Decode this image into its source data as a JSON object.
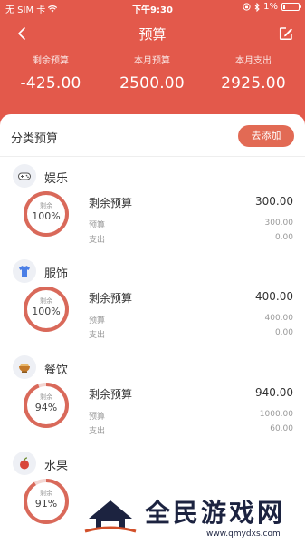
{
  "status_bar": {
    "carrier": "无 SIM 卡",
    "time": "下午9:30",
    "battery_pct": "1%"
  },
  "header": {
    "title": "预算"
  },
  "summary": [
    {
      "label": "剩余预算",
      "value": "-425.00"
    },
    {
      "label": "本月预算",
      "value": "2500.00"
    },
    {
      "label": "本月支出",
      "value": "2925.00"
    }
  ],
  "section": {
    "title": "分类预算",
    "add_label": "去添加"
  },
  "categories": [
    {
      "name": "娱乐",
      "icon": "game-controller-icon",
      "ring_label": "剩余",
      "ring_value": "100%",
      "ring_fraction": 1.0,
      "remaining_label": "剩余预算",
      "remaining": "300.00",
      "budget_label": "预算",
      "budget": "300.00",
      "expense_label": "支出",
      "expense": "0.00"
    },
    {
      "name": "服饰",
      "icon": "shirt-icon",
      "ring_label": "剩余",
      "ring_value": "100%",
      "ring_fraction": 1.0,
      "remaining_label": "剩余预算",
      "remaining": "400.00",
      "budget_label": "预算",
      "budget": "400.00",
      "expense_label": "支出",
      "expense": "0.00"
    },
    {
      "name": "餐饮",
      "icon": "food-bowl-icon",
      "ring_label": "剩余",
      "ring_value": "94%",
      "ring_fraction": 0.94,
      "remaining_label": "剩余预算",
      "remaining": "940.00",
      "budget_label": "预算",
      "budget": "1000.00",
      "expense_label": "支出",
      "expense": "60.00"
    },
    {
      "name": "水果",
      "icon": "apple-icon",
      "ring_label": "剩余",
      "ring_value": "91%",
      "ring_fraction": 0.91
    }
  ],
  "watermark": {
    "text": "全民游戏网",
    "url": "www.qmydxs.com"
  },
  "colors": {
    "accent": "#e3594b",
    "ring": "#d9695a",
    "ring_track": "#f3d6d2",
    "button": "#e26a54"
  }
}
